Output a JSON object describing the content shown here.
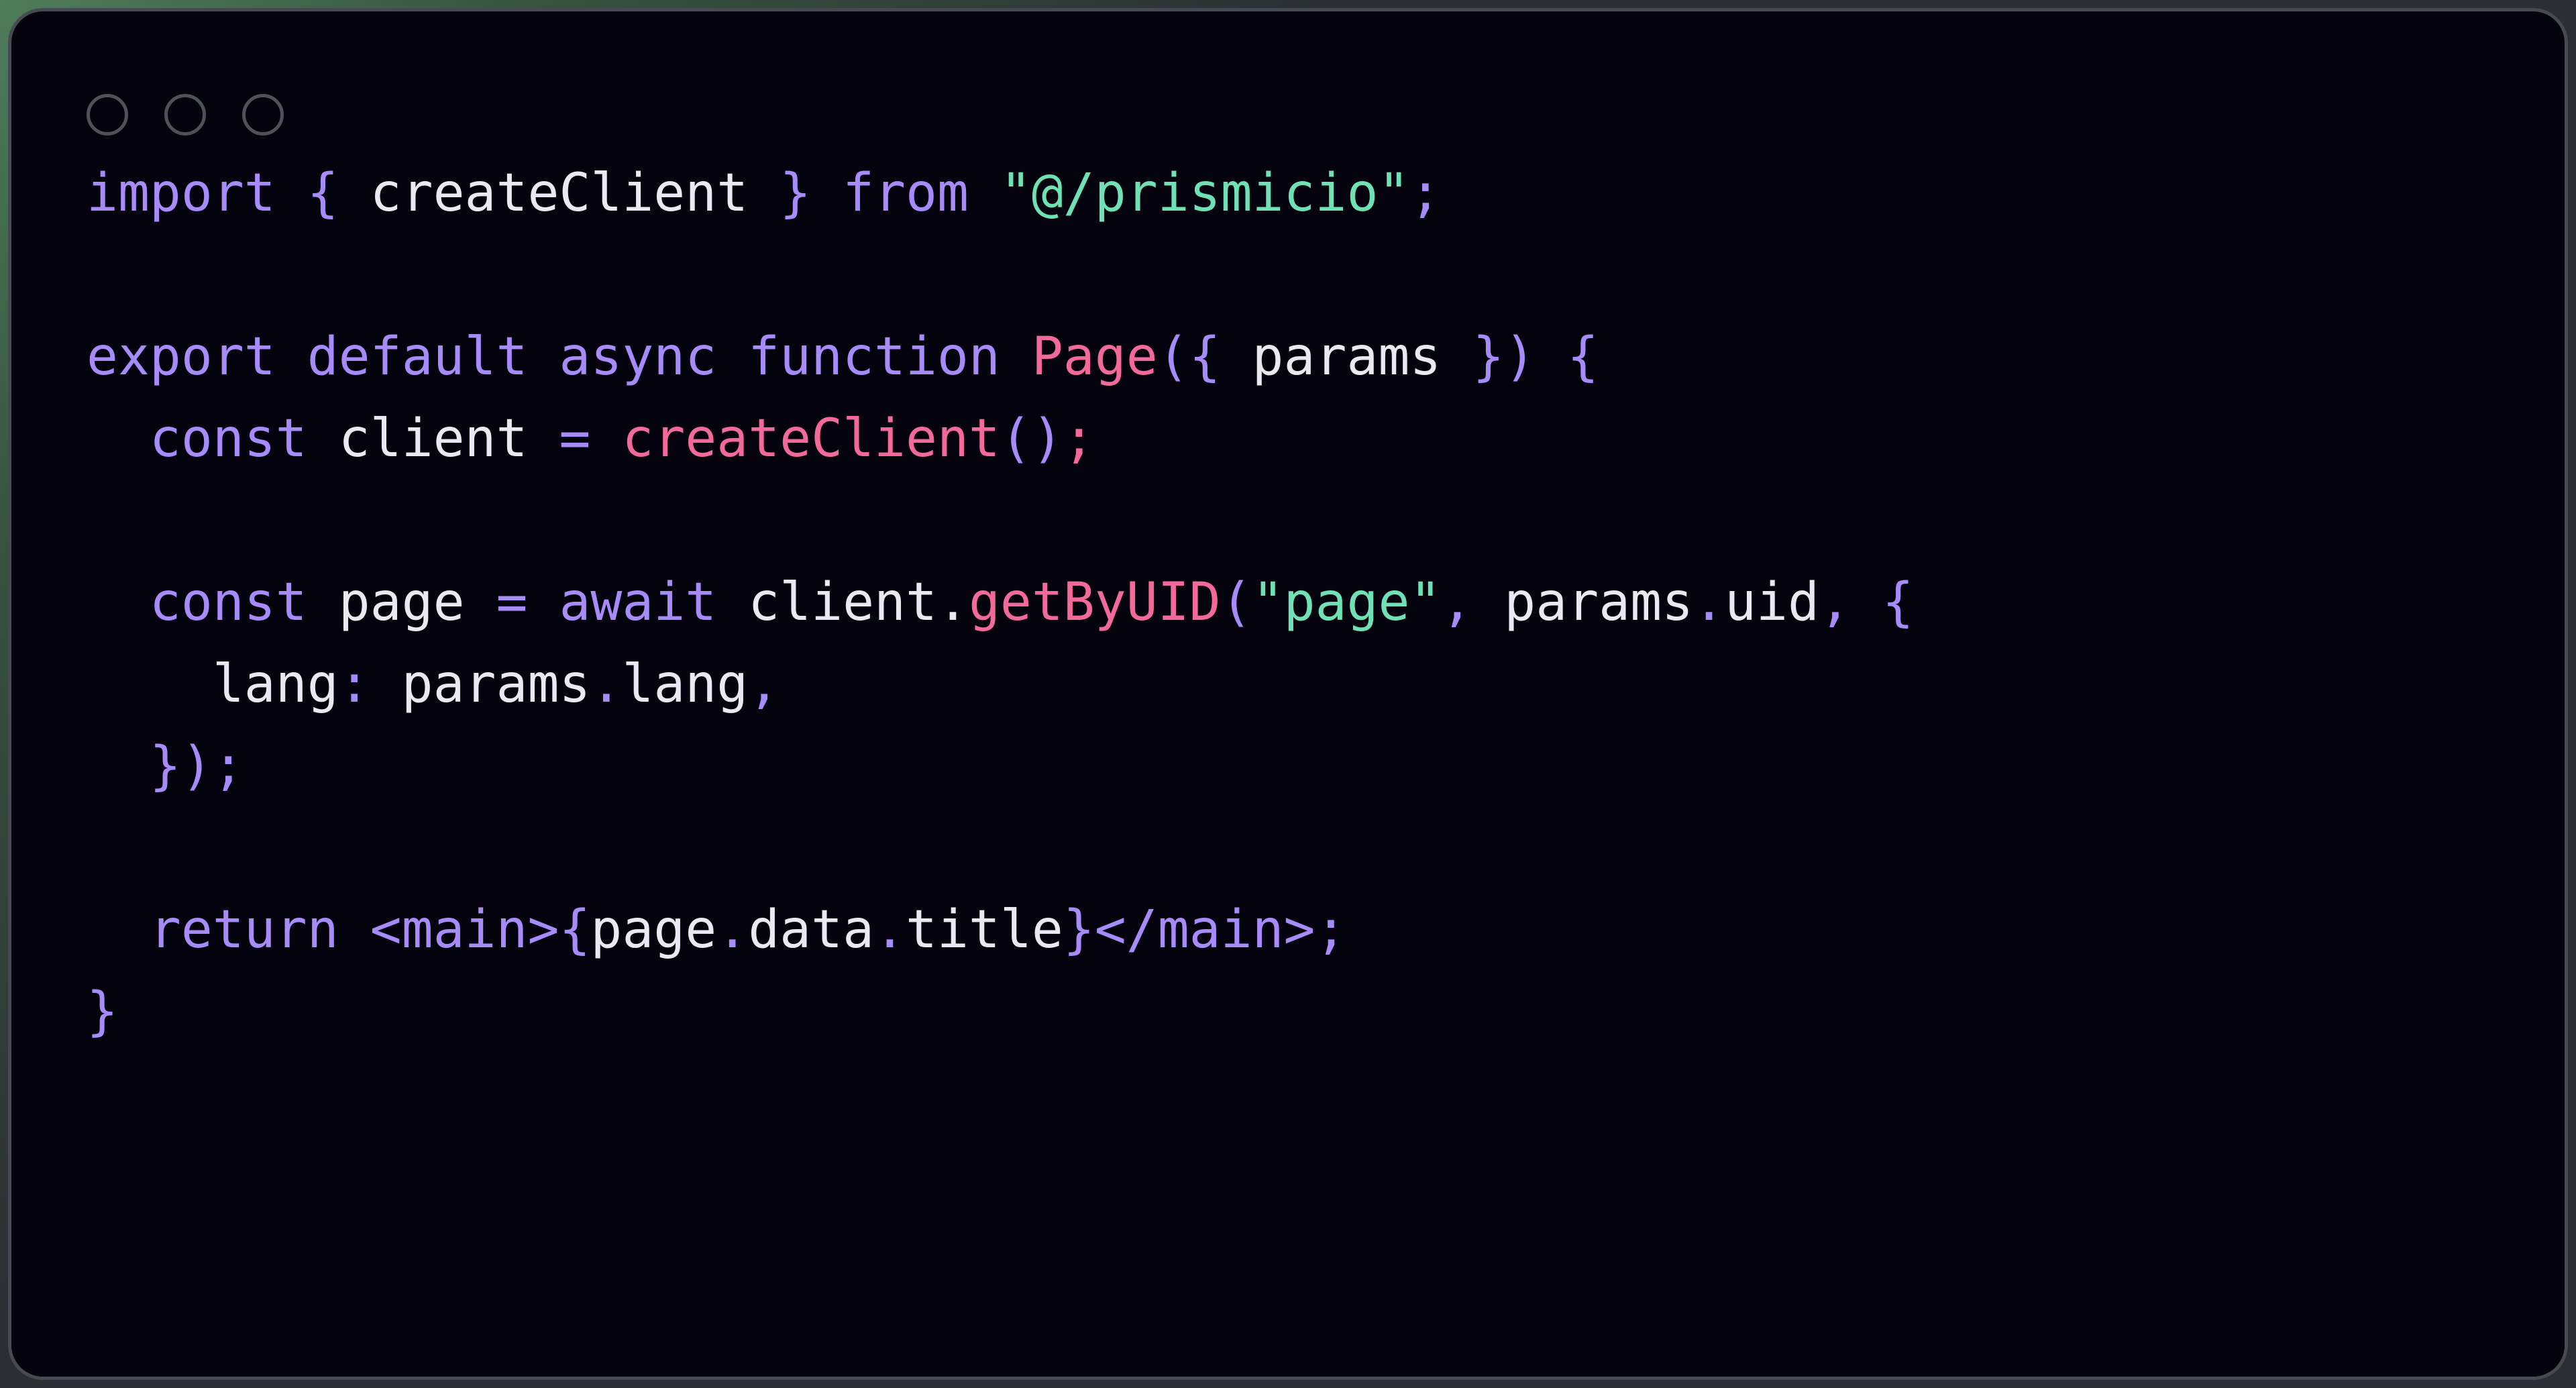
{
  "window": {
    "dots": [
      {
        "name": "close-dot",
        "color": "#4e515a"
      },
      {
        "name": "minimize-dot",
        "color": "#4e515a"
      },
      {
        "name": "maximize-dot",
        "color": "#4e515a"
      }
    ]
  },
  "theme": {
    "card_background": "#05030e",
    "card_border": "#474a52",
    "backdrop": "#3a3d42",
    "keyword": "#a78bfa",
    "function": "#f4699c",
    "string": "#6ee2b4",
    "identifier": "#e9e9f0"
  },
  "code": {
    "language": "tsx",
    "plain_text": "import { createClient } from \"@/prismicio\";\n\nexport default async function Page({ params }) {\n  const client = createClient();\n\n  const page = await client.getByUID(\"page\", params.uid, {\n    lang: params.lang,\n  });\n\n  return <main>{page.data.title}</main>;\n}",
    "lines": [
      {
        "n": 1,
        "tokens": [
          {
            "t": "import",
            "c": "kw"
          },
          {
            "t": " ",
            "c": "var"
          },
          {
            "t": "{",
            "c": "kw"
          },
          {
            "t": " createClient ",
            "c": "var"
          },
          {
            "t": "}",
            "c": "kw"
          },
          {
            "t": " ",
            "c": "var"
          },
          {
            "t": "from",
            "c": "kw"
          },
          {
            "t": " ",
            "c": "var"
          },
          {
            "t": "\"@/prismicio\"",
            "c": "str"
          },
          {
            "t": ";",
            "c": "kw"
          }
        ]
      },
      {
        "n": 2,
        "tokens": []
      },
      {
        "n": 3,
        "tokens": [
          {
            "t": "export default async function",
            "c": "kw"
          },
          {
            "t": " ",
            "c": "var"
          },
          {
            "t": "Page",
            "c": "fn"
          },
          {
            "t": "({",
            "c": "kw"
          },
          {
            "t": " params ",
            "c": "var"
          },
          {
            "t": "})",
            "c": "kw"
          },
          {
            "t": " ",
            "c": "var"
          },
          {
            "t": "{",
            "c": "kw"
          }
        ]
      },
      {
        "n": 4,
        "tokens": [
          {
            "t": "  ",
            "c": "var"
          },
          {
            "t": "const",
            "c": "kw"
          },
          {
            "t": " client ",
            "c": "var"
          },
          {
            "t": "=",
            "c": "kw"
          },
          {
            "t": " ",
            "c": "var"
          },
          {
            "t": "createClient",
            "c": "fn"
          },
          {
            "t": "()",
            "c": "kw"
          },
          {
            "t": ";",
            "c": "fn"
          }
        ]
      },
      {
        "n": 5,
        "tokens": []
      },
      {
        "n": 6,
        "tokens": [
          {
            "t": "  ",
            "c": "var"
          },
          {
            "t": "const",
            "c": "kw"
          },
          {
            "t": " page ",
            "c": "var"
          },
          {
            "t": "=",
            "c": "kw"
          },
          {
            "t": " ",
            "c": "var"
          },
          {
            "t": "await",
            "c": "kw"
          },
          {
            "t": " client",
            "c": "var"
          },
          {
            "t": ".",
            "c": "var"
          },
          {
            "t": "getByUID",
            "c": "fn"
          },
          {
            "t": "(",
            "c": "kw"
          },
          {
            "t": "\"page\"",
            "c": "str"
          },
          {
            "t": ",",
            "c": "kw"
          },
          {
            "t": " params",
            "c": "var"
          },
          {
            "t": ".",
            "c": "kw"
          },
          {
            "t": "uid",
            "c": "var"
          },
          {
            "t": ",",
            "c": "kw"
          },
          {
            "t": " ",
            "c": "var"
          },
          {
            "t": "{",
            "c": "kw"
          }
        ]
      },
      {
        "n": 7,
        "tokens": [
          {
            "t": "    ",
            "c": "var"
          },
          {
            "t": "lang",
            "c": "var"
          },
          {
            "t": ":",
            "c": "kw"
          },
          {
            "t": " params",
            "c": "var"
          },
          {
            "t": ".",
            "c": "kw"
          },
          {
            "t": "lang",
            "c": "var"
          },
          {
            "t": ",",
            "c": "kw"
          }
        ]
      },
      {
        "n": 8,
        "tokens": [
          {
            "t": "  ",
            "c": "var"
          },
          {
            "t": "});",
            "c": "kw"
          }
        ]
      },
      {
        "n": 9,
        "tokens": []
      },
      {
        "n": 10,
        "tokens": [
          {
            "t": "  ",
            "c": "var"
          },
          {
            "t": "return",
            "c": "kw"
          },
          {
            "t": " ",
            "c": "var"
          },
          {
            "t": "<main>",
            "c": "tag"
          },
          {
            "t": "{",
            "c": "kw"
          },
          {
            "t": "page",
            "c": "var"
          },
          {
            "t": ".",
            "c": "kw"
          },
          {
            "t": "data",
            "c": "var"
          },
          {
            "t": ".",
            "c": "kw"
          },
          {
            "t": "title",
            "c": "var"
          },
          {
            "t": "}",
            "c": "kw"
          },
          {
            "t": "</main>",
            "c": "tag"
          },
          {
            "t": ";",
            "c": "kw"
          }
        ]
      },
      {
        "n": 11,
        "tokens": [
          {
            "t": "}",
            "c": "kw"
          }
        ]
      }
    ]
  }
}
